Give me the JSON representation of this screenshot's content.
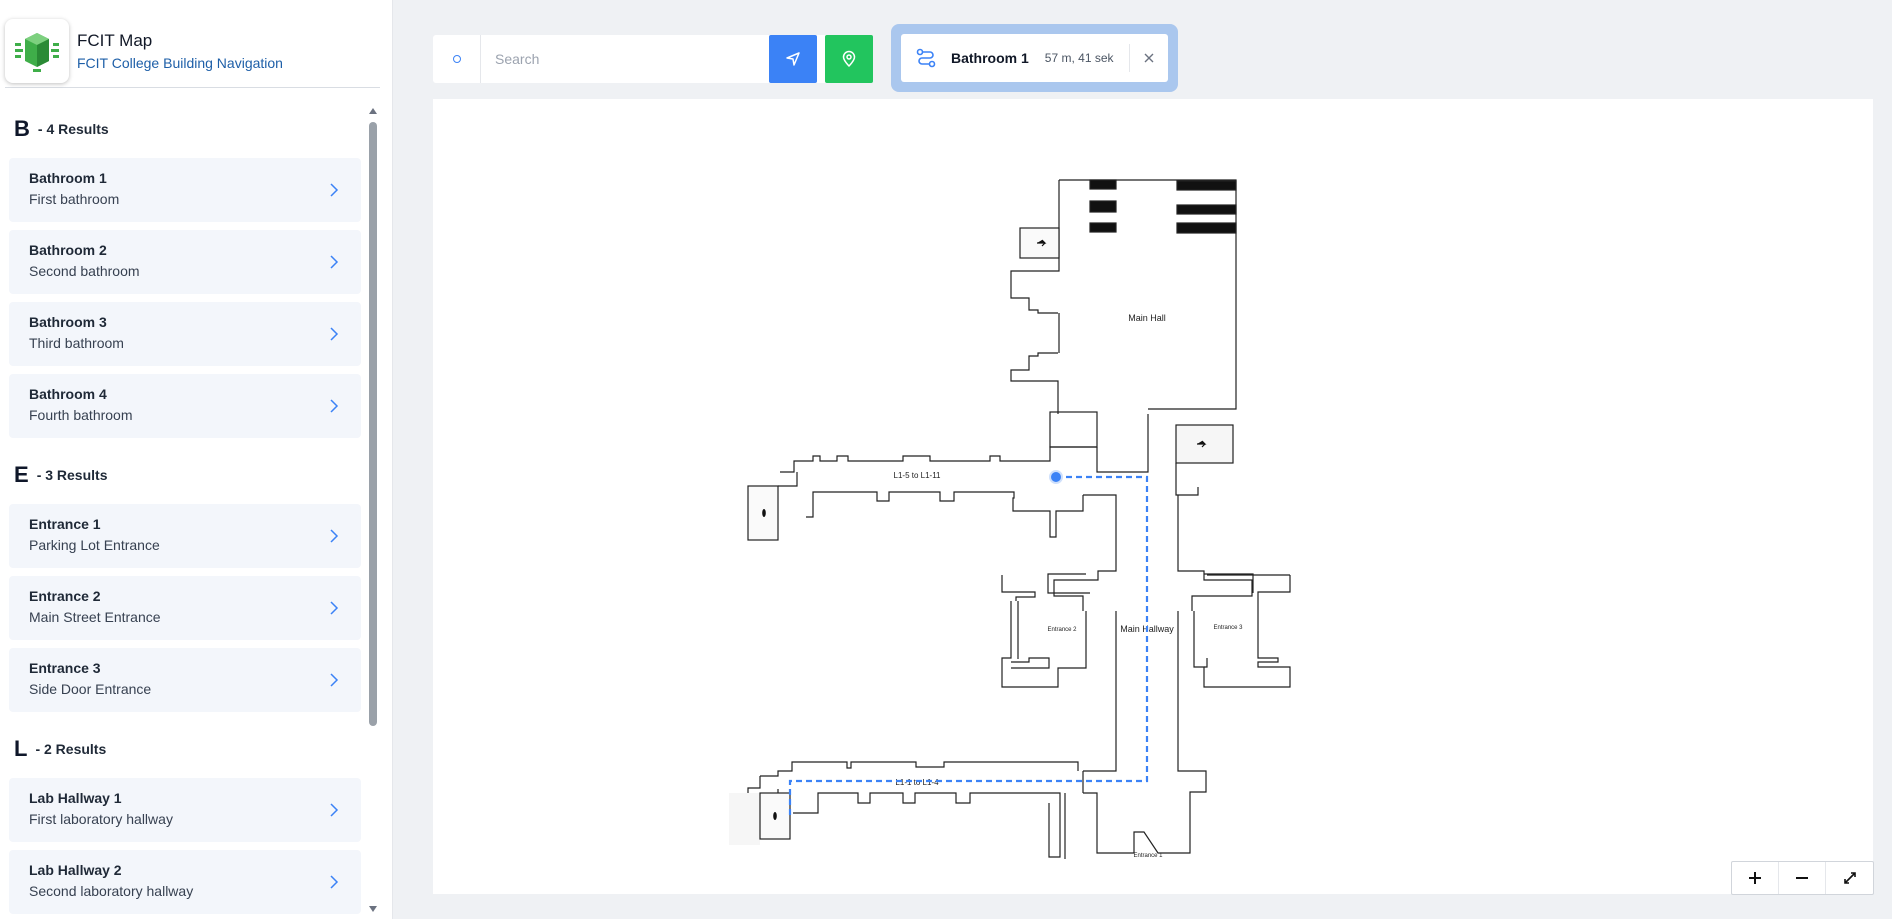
{
  "app": {
    "title": "FCIT Map",
    "subtitle": "FCIT College Building Navigation"
  },
  "search": {
    "placeholder": "Search",
    "value": ""
  },
  "route": {
    "destination": "Bathroom 1",
    "duration": "57 m, 41 sek"
  },
  "groups": [
    {
      "letter": "B",
      "count": "- 4 Results",
      "items": [
        {
          "name": "Bathroom 1",
          "desc": "First bathroom"
        },
        {
          "name": "Bathroom 2",
          "desc": "Second bathroom"
        },
        {
          "name": "Bathroom 3",
          "desc": "Third bathroom"
        },
        {
          "name": "Bathroom 4",
          "desc": "Fourth bathroom"
        }
      ]
    },
    {
      "letter": "E",
      "count": "- 3 Results",
      "items": [
        {
          "name": "Entrance 1",
          "desc": "Parking Lot Entrance"
        },
        {
          "name": "Entrance 2",
          "desc": "Main Street Entrance"
        },
        {
          "name": "Entrance 3",
          "desc": "Side Door Entrance"
        }
      ]
    },
    {
      "letter": "L",
      "count": "- 2 Results",
      "items": [
        {
          "name": "Lab Hallway 1",
          "desc": "First laboratory hallway"
        },
        {
          "name": "Lab Hallway 2",
          "desc": "Second laboratory hallway"
        }
      ]
    }
  ],
  "map": {
    "labels": {
      "main_hall": "Main Hall",
      "main_hallway": "Main Hallway",
      "corridor_upper": "L1-5 to L1-11",
      "corridor_lower": "L1-1 to L1-4",
      "entrance_1": "Entrance 1",
      "entrance_2": "Entrance 2",
      "entrance_3": "Entrance 3"
    }
  },
  "colors": {
    "primary": "#3b82f6",
    "success": "#22c55e",
    "brand_blue": "#1e5fa8",
    "route_highlight": "#aac7ee"
  },
  "icons": {
    "search": "circle-icon",
    "navigate": "navigation-arrow-icon",
    "pin": "map-pin-icon",
    "route": "route-icon",
    "close": "close-icon",
    "zoom_in": "plus-icon",
    "zoom_out": "minus-icon",
    "fullscreen": "expand-icon"
  }
}
